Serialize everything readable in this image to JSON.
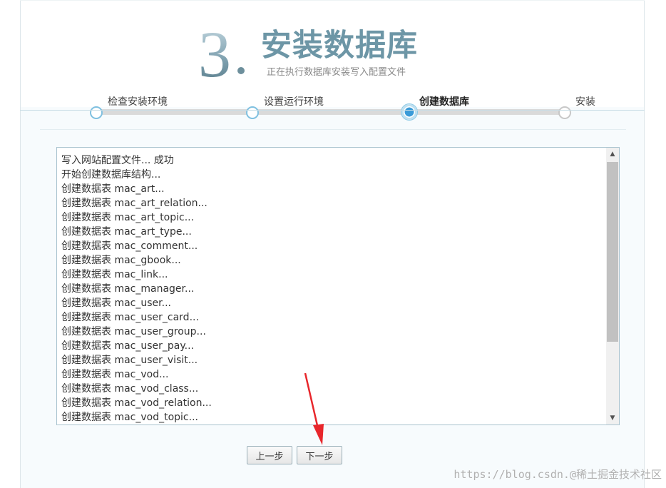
{
  "header": {
    "step_number": "3",
    "title": "安装数据库",
    "subtitle": "正在执行数据库安装写入配置文件"
  },
  "progress": {
    "steps": [
      {
        "label": "检查安装环境",
        "state": "done"
      },
      {
        "label": "设置运行环境",
        "state": "done"
      },
      {
        "label": "创建数据库",
        "state": "active"
      },
      {
        "label": "安装",
        "state": "pending"
      }
    ]
  },
  "log": {
    "lines": [
      "写入网站配置文件... 成功",
      "开始创建数据库结构...",
      "创建数据表 mac_art...",
      "创建数据表 mac_art_relation...",
      "创建数据表 mac_art_topic...",
      "创建数据表 mac_art_type...",
      "创建数据表 mac_comment...",
      "创建数据表 mac_gbook...",
      "创建数据表 mac_link...",
      "创建数据表 mac_manager...",
      "创建数据表 mac_user...",
      "创建数据表 mac_user_card...",
      "创建数据表 mac_user_group...",
      "创建数据表 mac_user_pay...",
      "创建数据表 mac_user_visit...",
      "创建数据表 mac_vod...",
      "创建数据表 mac_vod_class...",
      "创建数据表 mac_vod_relation...",
      "创建数据表 mac_vod_topic..."
    ]
  },
  "buttons": {
    "prev_label": "上一步",
    "next_label": "下一步"
  },
  "watermark": {
    "text": "https://blog.csdn.@稀土掘金技术社区"
  },
  "colors": {
    "title": "#6d96a6",
    "progress_active": "#3a9bd8",
    "annotation_arrow": "#e8262b"
  }
}
